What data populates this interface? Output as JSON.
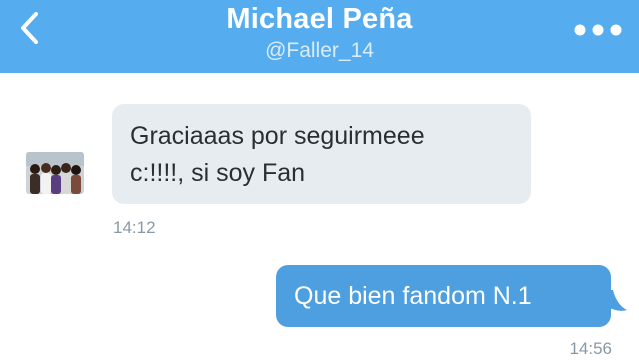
{
  "header": {
    "title": "Michael Peña",
    "subtitle": "@Faller_14",
    "back_icon": "chevron-left-icon",
    "more_icon": "more-dots-icon",
    "background": "#55acee"
  },
  "messages": [
    {
      "direction": "incoming",
      "line1": "Graciaaas por seguirmeee",
      "line2": "c:!!!!, si soy Fan",
      "time": "14:12",
      "bubble_color": "#e6ecf0"
    },
    {
      "direction": "outgoing",
      "text": "Que bien fandom N.1",
      "time": "14:56",
      "bubble_color": "#4d9fe0"
    }
  ]
}
